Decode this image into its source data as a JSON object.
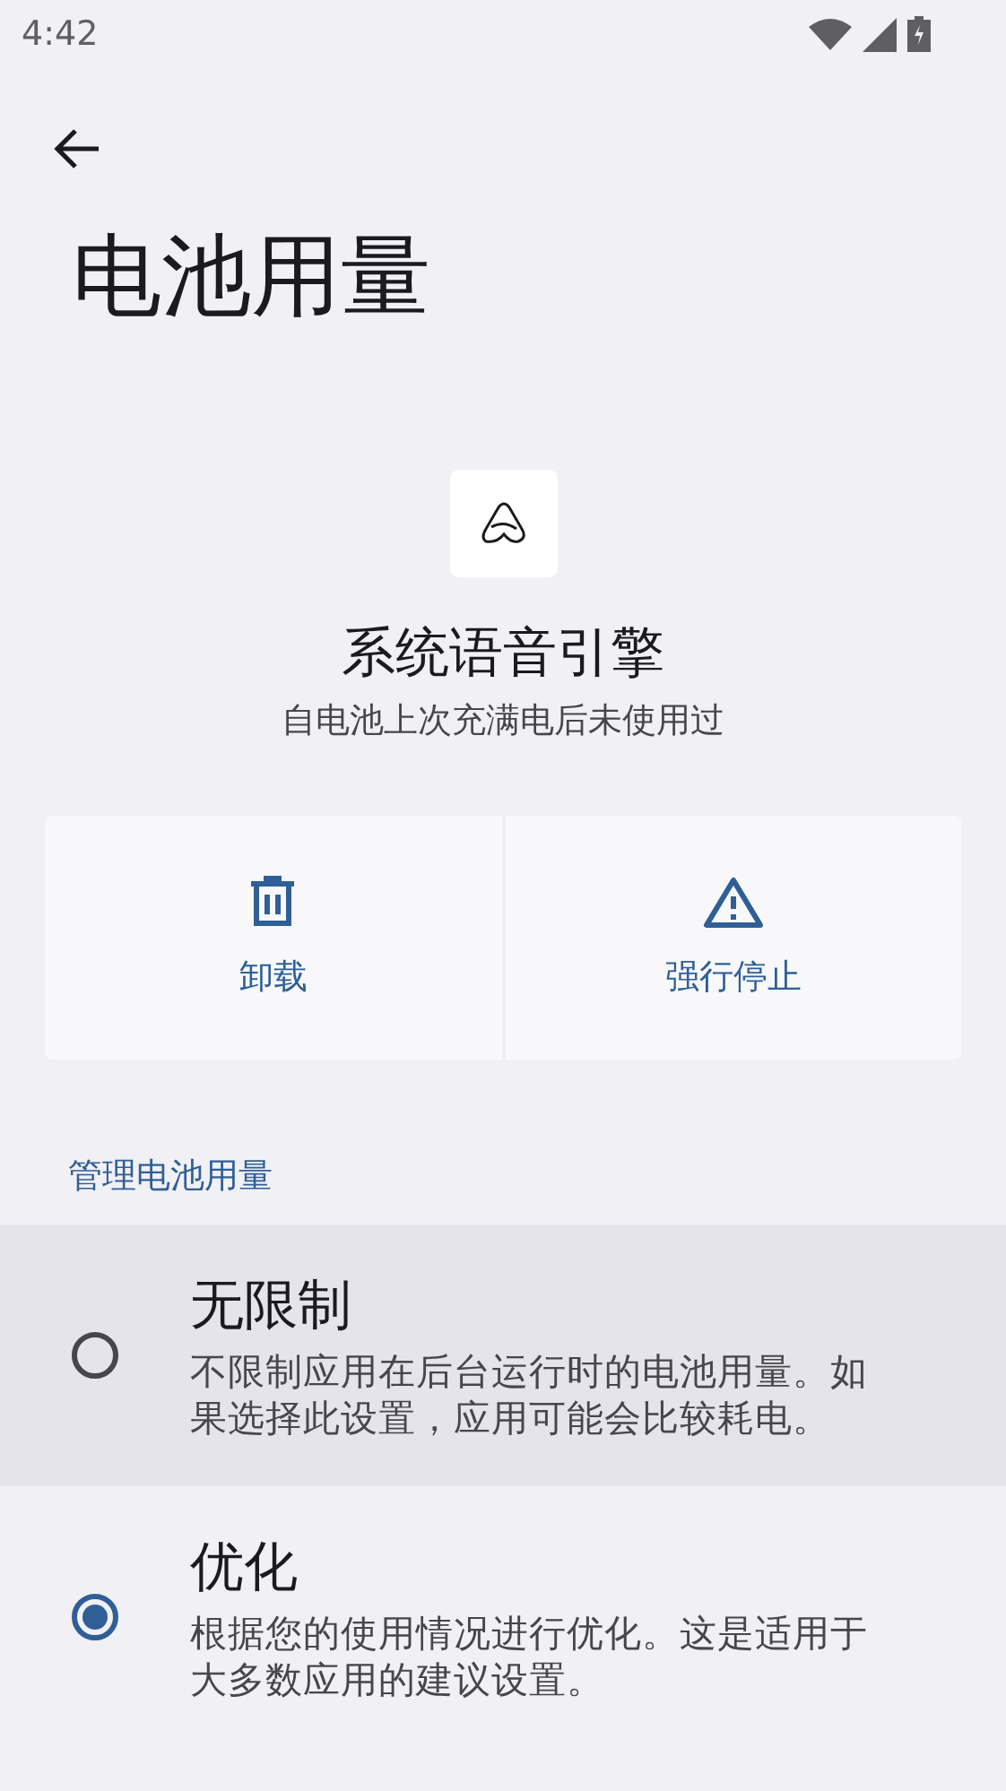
{
  "status_bar": {
    "time": "4:42"
  },
  "page": {
    "title": "电池用量"
  },
  "app": {
    "name": "系统语音引擎",
    "subtitle": "自电池上次充满电后未使用过"
  },
  "actions": [
    {
      "kind": "uninstall",
      "label": "卸载"
    },
    {
      "kind": "force_stop",
      "label": "强行停止"
    }
  ],
  "section": {
    "title": "管理电池用量"
  },
  "options": [
    {
      "title": "无限制",
      "description": "不限制应用在后台运行时的电池用量。如果选择此设置，应用可能会比较耗电。",
      "selected": false,
      "highlighted": true
    },
    {
      "title": "优化",
      "description": "根据您的使用情况进行优化。这是适用于大多数应用的建议设置。",
      "selected": true,
      "highlighted": false
    }
  ]
}
